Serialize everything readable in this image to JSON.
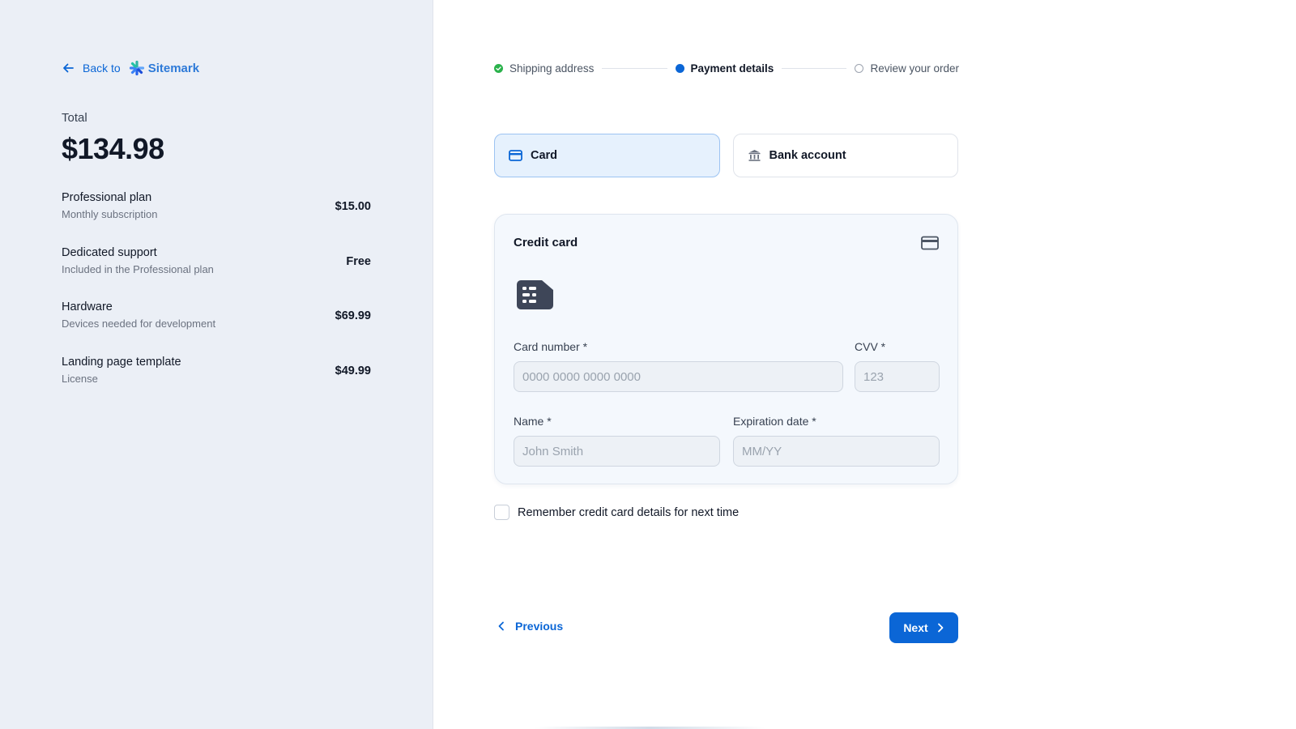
{
  "sidebar": {
    "back_label": "Back to",
    "brand": "Sitemark",
    "total_label": "Total",
    "total_value": "$134.98",
    "items": [
      {
        "name": "Professional plan",
        "desc": "Monthly subscription",
        "price": "$15.00"
      },
      {
        "name": "Dedicated support",
        "desc": "Included in the Professional plan",
        "price": "Free"
      },
      {
        "name": "Hardware",
        "desc": "Devices needed for development",
        "price": "$69.99"
      },
      {
        "name": "Landing page template",
        "desc": "License",
        "price": "$49.99"
      }
    ]
  },
  "stepper": {
    "steps": [
      {
        "label": "Shipping address",
        "state": "done"
      },
      {
        "label": "Payment details",
        "state": "active"
      },
      {
        "label": "Review your order",
        "state": "todo"
      }
    ]
  },
  "methods": {
    "card_label": "Card",
    "bank_label": "Bank account"
  },
  "card_form": {
    "title": "Credit card",
    "card_number_label": "Card number *",
    "card_number_placeholder": "0000 0000 0000 0000",
    "cvv_label": "CVV *",
    "cvv_placeholder": "123",
    "name_label": "Name *",
    "name_placeholder": "John Smith",
    "expiration_label": "Expiration date *",
    "expiration_placeholder": "MM/YY"
  },
  "remember_label": "Remember credit card details for next time",
  "nav": {
    "previous_label": "Previous",
    "next_label": "Next"
  },
  "colors": {
    "accent": "#0b66d6",
    "success": "#2bb24c",
    "sidebar_bg": "#ebeff6"
  }
}
